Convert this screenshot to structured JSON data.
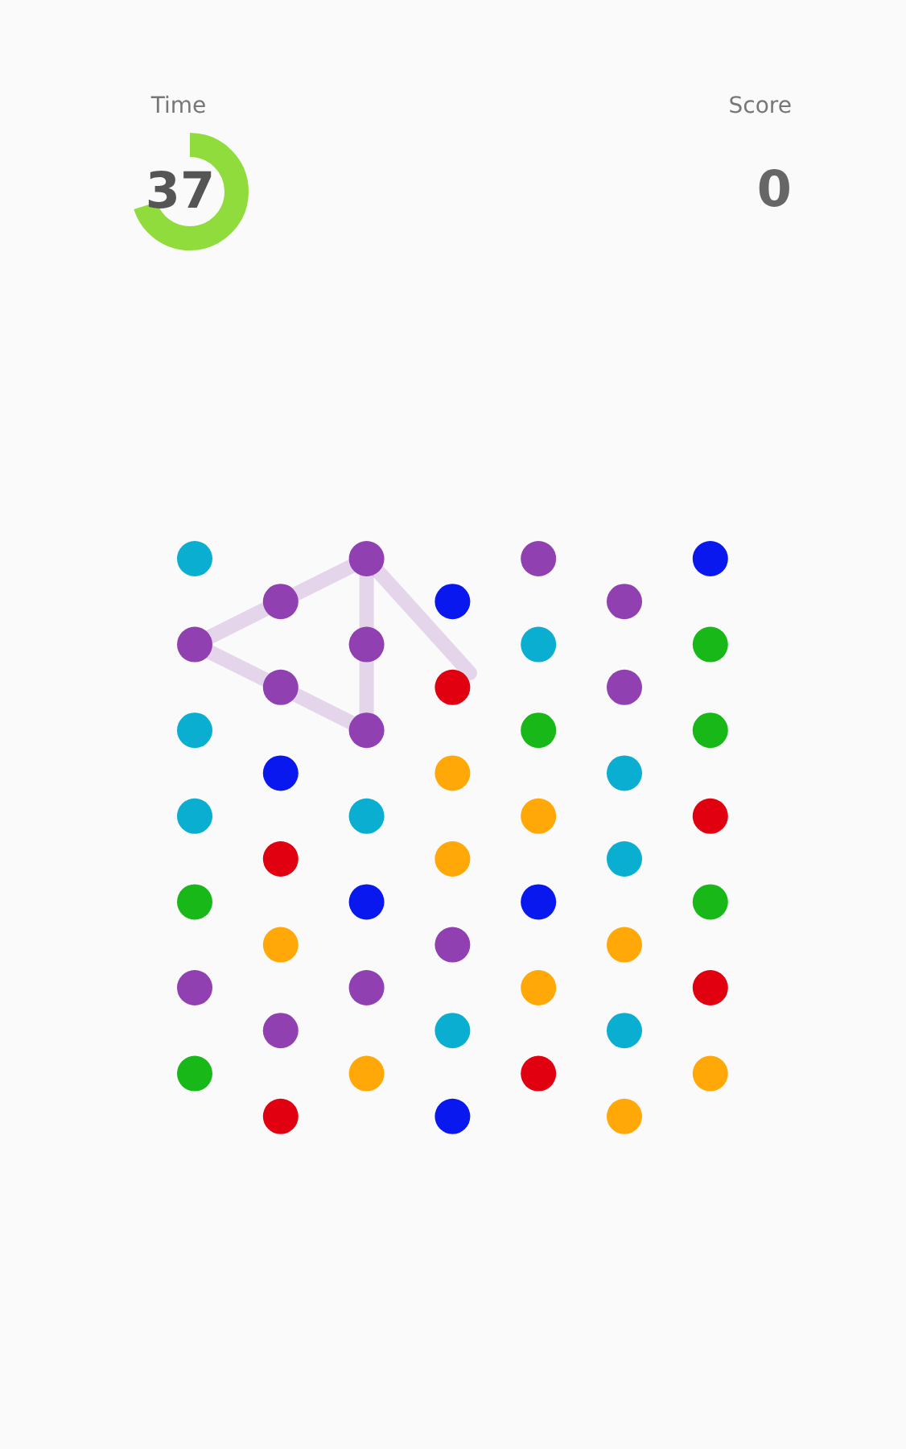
{
  "timer": {
    "label": "Time",
    "value": "37",
    "level": 0.7
  },
  "score": {
    "label": "Score",
    "value": "0"
  },
  "board": {
    "columns": [
      {
        "dots": [
          {
            "color": "#0aaed0"
          },
          {
            "color": "#9040b0"
          },
          {
            "color": "#0aaed0"
          },
          {
            "color": "#0aaed0"
          },
          {
            "color": "#18b818"
          },
          {
            "color": "#9040b0"
          },
          {
            "color": "#18b818"
          }
        ]
      },
      {
        "dots": [
          {
            "color": "#9040b0"
          },
          {
            "color": "#9040b0"
          },
          {
            "color": "#0a18f0"
          },
          {
            "color": "#e00010"
          },
          {
            "color": "#ffa808"
          },
          {
            "color": "#9040b0"
          },
          {
            "color": "#e00010"
          }
        ]
      },
      {
        "dots": [
          {
            "color": "#9040b0"
          },
          {
            "color": "#9040b0"
          },
          {
            "color": "#9040b0"
          },
          {
            "color": "#0aaed0"
          },
          {
            "color": "#0a18f0"
          },
          {
            "color": "#9040b0"
          },
          {
            "color": "#ffa808"
          }
        ]
      },
      {
        "dots": [
          {
            "color": "#0a18f0"
          },
          {
            "color": "#e00010"
          },
          {
            "color": "#ffa808"
          },
          {
            "color": "#ffa808"
          },
          {
            "color": "#9040b0"
          },
          {
            "color": "#0aaed0"
          },
          {
            "color": "#0a18f0"
          }
        ]
      },
      {
        "dots": [
          {
            "color": "#9040b0"
          },
          {
            "color": "#0aaed0"
          },
          {
            "color": "#18b818"
          },
          {
            "color": "#ffa808"
          },
          {
            "color": "#0a18f0"
          },
          {
            "color": "#ffa808"
          },
          {
            "color": "#e00010"
          }
        ]
      },
      {
        "dots": [
          {
            "color": "#9040b0"
          },
          {
            "color": "#9040b0"
          },
          {
            "color": "#0aaed0"
          },
          {
            "color": "#0aaed0"
          },
          {
            "color": "#ffa808"
          },
          {
            "color": "#0aaed0"
          },
          {
            "color": "#ffa808"
          }
        ]
      },
      {
        "dots": [
          {
            "color": "#0a18f0"
          },
          {
            "color": "#18b818"
          },
          {
            "color": "#18b818"
          },
          {
            "color": "#e00010"
          },
          {
            "color": "#18b818"
          },
          {
            "color": "#e00010"
          },
          {
            "color": "#ffa808"
          }
        ]
      }
    ]
  }
}
